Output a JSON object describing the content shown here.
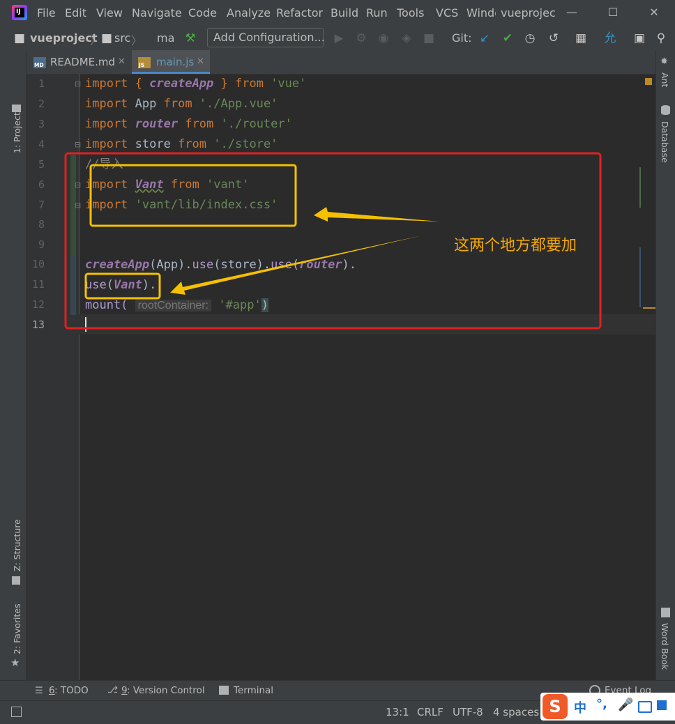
{
  "menu": [
    "File",
    "Edit",
    "View",
    "Navigate",
    "Code",
    "Analyze",
    "Refactor",
    "Build",
    "Run",
    "Tools",
    "VCS",
    "Windo"
  ],
  "window_title": "vueprojec",
  "breadcrumb": {
    "project": "vueproject",
    "folder": "src",
    "file": "ma"
  },
  "toolbar": {
    "run_config": "Add Configuration...",
    "git_label": "Git:"
  },
  "left_tools": {
    "project": "1: Project",
    "structure": "Z: Structure",
    "favorites": "2: Favorites"
  },
  "right_tools": {
    "ant": "Ant",
    "database": "Database",
    "wordbook": "Word Book"
  },
  "tabs": [
    {
      "label": "README.md",
      "icon": "MD",
      "active": false
    },
    {
      "label": "main.js",
      "icon": "JS",
      "active": true
    }
  ],
  "line_numbers": [
    "1",
    "2",
    "3",
    "4",
    "5",
    "6",
    "7",
    "8",
    "9",
    "10",
    "11",
    "12",
    "13"
  ],
  "code": {
    "l1": {
      "import": "import",
      "brace_open": "{ ",
      "createApp": "createApp",
      "brace_close": " }",
      "from": " from ",
      "path": "'vue'"
    },
    "l2": {
      "import": "import",
      "name": " App",
      "from": " from ",
      "path": "'./App.vue'"
    },
    "l3": {
      "import": "import",
      "name": "router",
      "from": " from ",
      "path": "'./router'"
    },
    "l4": {
      "import": "import",
      "name": " store",
      "from": " from ",
      "path": "'./store'"
    },
    "l5": {
      "comment": "//导入"
    },
    "l6": {
      "import": "import",
      "name": "Vant",
      "from": " from ",
      "path": "'vant'"
    },
    "l7": {
      "import": "import",
      "path": "'vant/lib/index.css'"
    },
    "l10": {
      "fn": "createApp",
      "args": "(App).",
      "use1": "use",
      "args2": "(store).",
      "use2": "use",
      "p": "(",
      "router": "router",
      "end": ")."
    },
    "l11": {
      "use": "use",
      "p": "(",
      "vant": "Vant",
      "end": ")."
    },
    "l12": {
      "mount": "mount(",
      "hint": "rootContainer:",
      "arg": "'#app'",
      "end": ")"
    }
  },
  "annotation": "这两个地方都要加",
  "tool_windows": [
    {
      "key": "6",
      "label": ": TODO"
    },
    {
      "key": "9",
      "label": ": Version Control"
    },
    {
      "key": "",
      "label": "Terminal"
    }
  ],
  "event_log": "Event Log",
  "status": {
    "position": "13:1",
    "line_sep": "CRLF",
    "encoding": "UTF-8",
    "indent": "4 spaces"
  },
  "ime": {
    "lang": "中",
    "punct": "°,"
  },
  "colors": {
    "annotation": "#f5a800",
    "box_red": "#e02020",
    "box_yellow": "#f5c000"
  }
}
